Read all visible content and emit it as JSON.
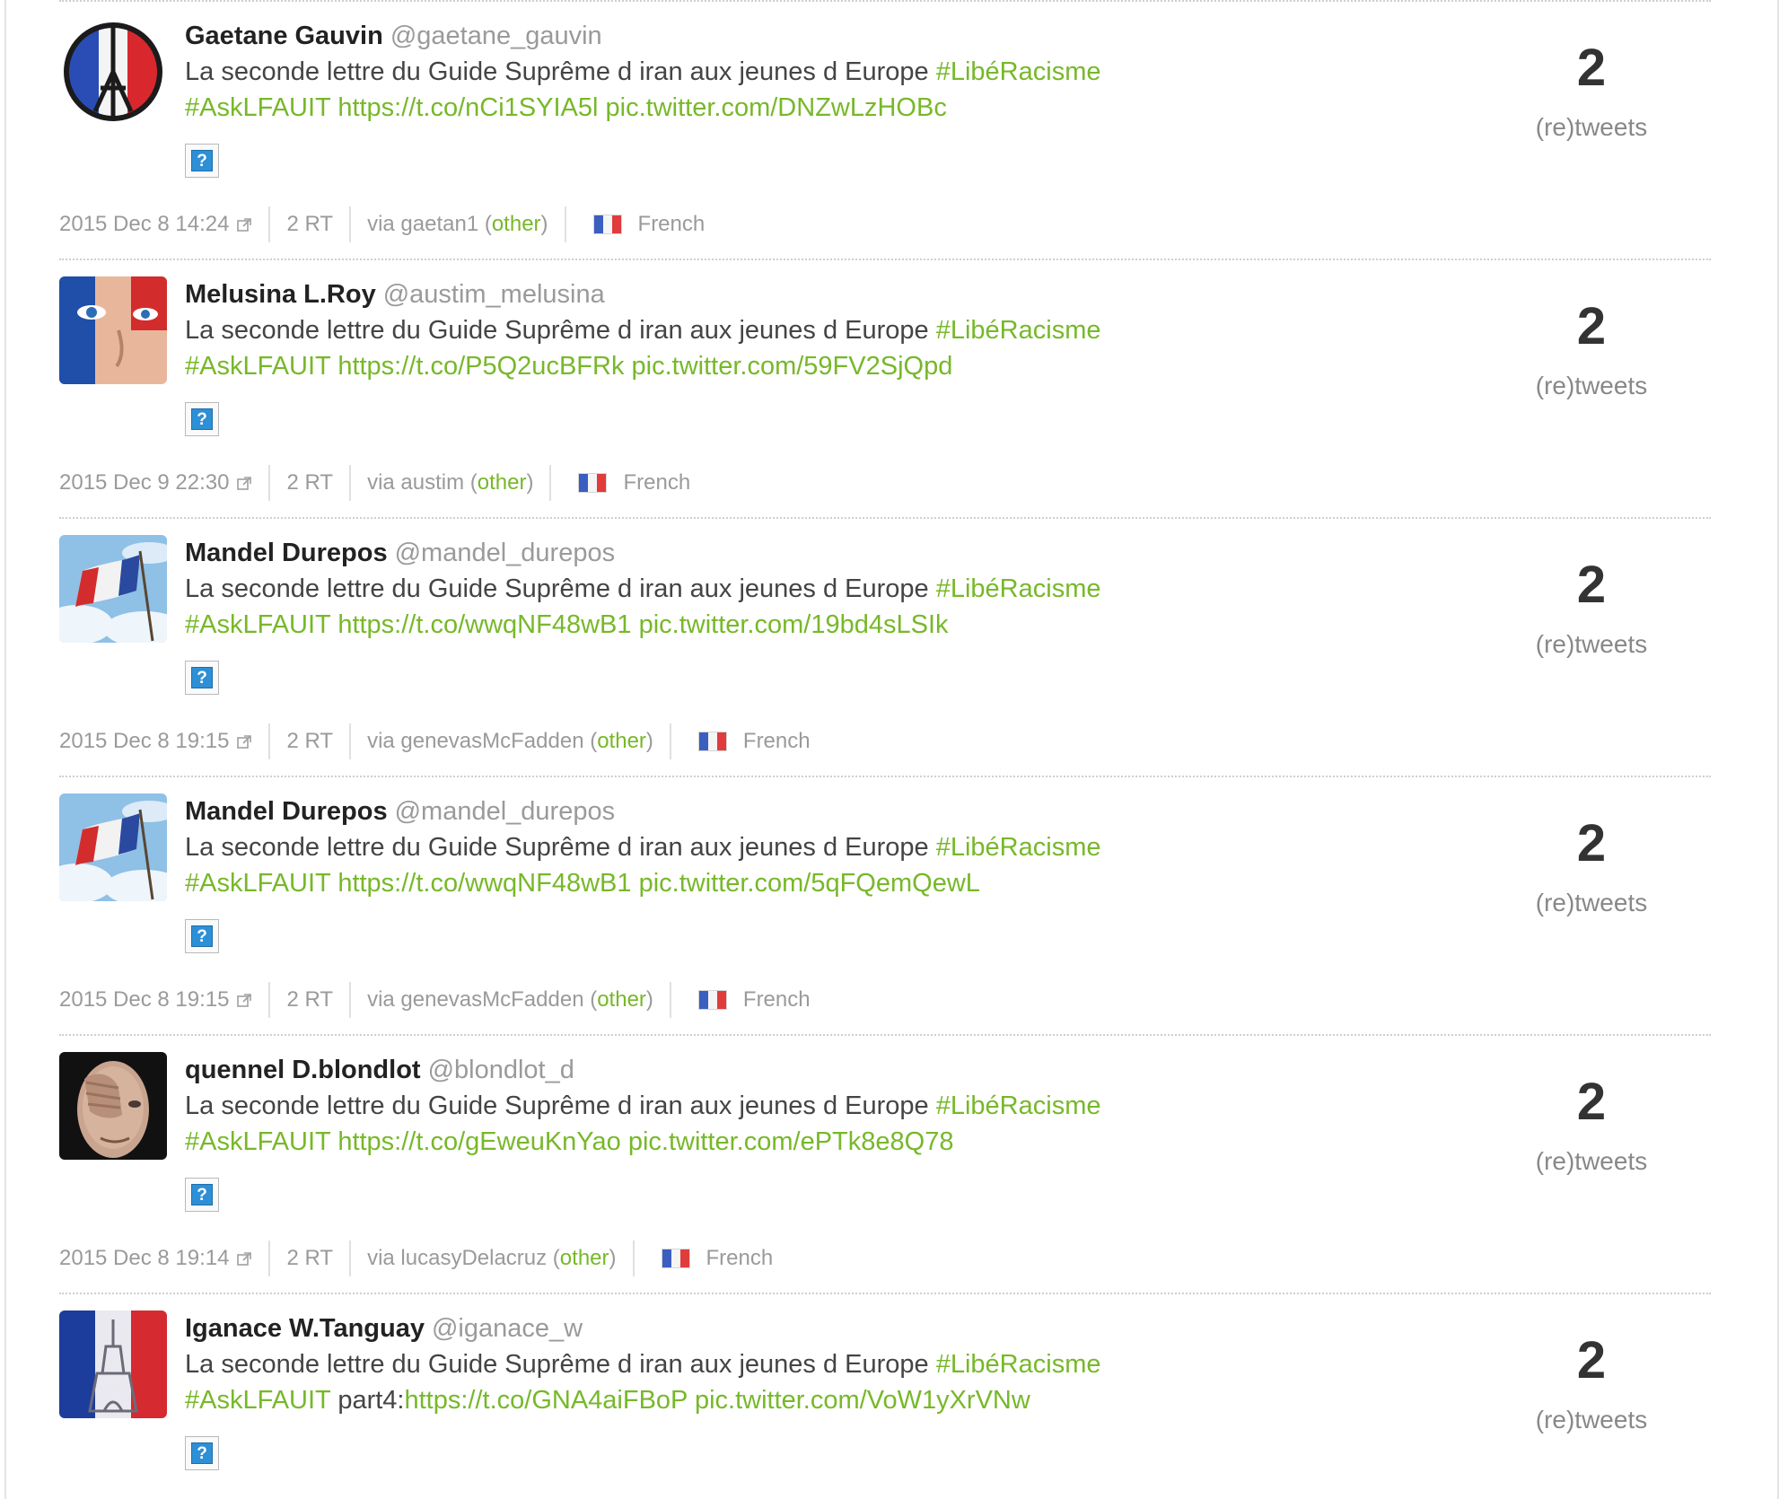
{
  "colors": {
    "link": "#77b829",
    "muted": "#9a9a9a",
    "text": "#444444"
  },
  "icons": {
    "external": "external-link-icon",
    "media": "question-mark-icon",
    "flag": "france-flag-icon"
  },
  "tweets": [
    {
      "name": "Gaetane Gauvin",
      "handle": "@gaetane_gauvin",
      "text_start": "La seconde lettre du Guide Suprême d iran aux jeunes d Europe ",
      "hashtag1": "#LibéRacisme",
      "hashtag2": "#AskLFAUIT",
      "mid_text": "",
      "url": "https://t.co/nCi1SYIA5l",
      "pic": "pic.twitter.com/DNZwLzHOBc",
      "media_label": "?",
      "count": "2",
      "count_label": "(re)tweets",
      "date": "2015 Dec 8 14:24",
      "rt": "2 RT",
      "via_prefix": "via gaetan1 (",
      "via_link": "other",
      "via_suffix": ")",
      "language": "French"
    },
    {
      "name": "Melusina L.Roy",
      "handle": "@austim_melusina",
      "text_start": "La seconde lettre du Guide Suprême d iran aux jeunes d Europe ",
      "hashtag1": "#LibéRacisme",
      "hashtag2": "#AskLFAUIT",
      "mid_text": "",
      "url": "https://t.co/P5Q2ucBFRk",
      "pic": "pic.twitter.com/59FV2SjQpd",
      "media_label": "?",
      "count": "2",
      "count_label": "(re)tweets",
      "date": "2015 Dec 9 22:30",
      "rt": "2 RT",
      "via_prefix": "via austim (",
      "via_link": "other",
      "via_suffix": ")",
      "language": "French"
    },
    {
      "name": "Mandel Durepos",
      "handle": "@mandel_durepos",
      "text_start": "La seconde lettre du Guide Suprême d iran aux jeunes d Europe ",
      "hashtag1": "#LibéRacisme",
      "hashtag2": "#AskLFAUIT",
      "mid_text": "",
      "url": "https://t.co/wwqNF48wB1",
      "pic": "pic.twitter.com/19bd4sLSIk",
      "media_label": "?",
      "count": "2",
      "count_label": "(re)tweets",
      "date": "2015 Dec 8 19:15",
      "rt": "2 RT",
      "via_prefix": "via genevasMcFadden (",
      "via_link": "other",
      "via_suffix": ")",
      "language": "French"
    },
    {
      "name": "Mandel Durepos",
      "handle": "@mandel_durepos",
      "text_start": "La seconde lettre du Guide Suprême d iran aux jeunes d Europe ",
      "hashtag1": "#LibéRacisme",
      "hashtag2": "#AskLFAUIT",
      "mid_text": "",
      "url": "https://t.co/wwqNF48wB1",
      "pic": "pic.twitter.com/5qFQemQewL",
      "media_label": "?",
      "count": "2",
      "count_label": "(re)tweets",
      "date": "2015 Dec 8 19:15",
      "rt": "2 RT",
      "via_prefix": "via genevasMcFadden (",
      "via_link": "other",
      "via_suffix": ")",
      "language": "French"
    },
    {
      "name": "quennel D.blondlot",
      "handle": "@blondlot_d",
      "text_start": "La seconde lettre du Guide Suprême d iran aux jeunes d Europe ",
      "hashtag1": "#LibéRacisme",
      "hashtag2": "#AskLFAUIT",
      "mid_text": "",
      "url": "https://t.co/gEweuKnYao",
      "pic": "pic.twitter.com/ePTk8e8Q78",
      "media_label": "?",
      "count": "2",
      "count_label": "(re)tweets",
      "date": "2015 Dec 8 19:14",
      "rt": "2 RT",
      "via_prefix": "via lucasyDelacruz (",
      "via_link": "other",
      "via_suffix": ")",
      "language": "French"
    },
    {
      "name": "Iganace W.Tanguay",
      "handle": "@iganace_w",
      "text_start": "La seconde lettre du Guide Suprême d iran aux jeunes d Europe ",
      "hashtag1": "#LibéRacisme",
      "hashtag2": "#AskLFAUIT",
      "mid_text": "part4:",
      "url": "https://t.co/GNA4aiFBoP",
      "pic": "pic.twitter.com/VoW1yXrVNw",
      "media_label": "?",
      "count": "2",
      "count_label": "(re)tweets"
    }
  ]
}
